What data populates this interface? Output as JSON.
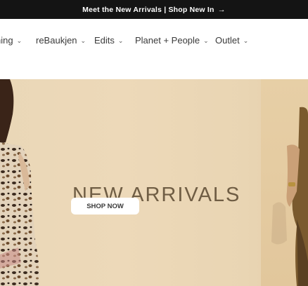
{
  "announcement": {
    "text": "Meet the New Arrivals | Shop New In",
    "arrow": "→"
  },
  "nav": {
    "items": [
      {
        "label": "hing",
        "icon": "chevron-down-icon"
      },
      {
        "label": "reBaukjen",
        "icon": "chevron-down-icon"
      },
      {
        "label": "Edits",
        "icon": "chevron-down-icon"
      },
      {
        "label": "Planet + People",
        "icon": "chevron-down-icon"
      },
      {
        "label": "Outlet",
        "icon": "chevron-down-icon"
      }
    ],
    "chevron": "⌄"
  },
  "hero": {
    "title": "NEW ARRIVALS",
    "cta_label": "SHOP NOW"
  },
  "colors": {
    "announcement_bg": "#141414",
    "hero_bg": "#ecd8b8",
    "title_text": "#6f5d44"
  }
}
